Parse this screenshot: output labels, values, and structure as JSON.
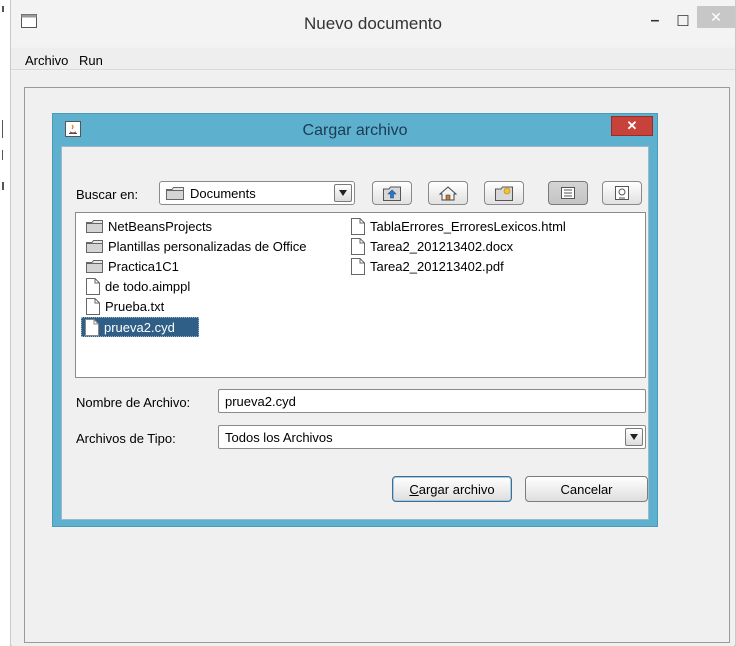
{
  "window": {
    "title": "Nuevo documento",
    "minimize_glyph": "–",
    "maximize_glyph": "☐",
    "close_glyph": "✕"
  },
  "menu": {
    "items": [
      "Archivo",
      "Run"
    ]
  },
  "dialog": {
    "title": "Cargar archivo",
    "close_glyph": "✕",
    "look_in_label": "Buscar en:",
    "look_in_value": "Documents",
    "files": [
      {
        "name": "NetBeansProjects",
        "type": "folder"
      },
      {
        "name": "Plantillas personalizadas de Office",
        "type": "folder"
      },
      {
        "name": "Practica1C1",
        "type": "folder"
      },
      {
        "name": "de todo.aimppl",
        "type": "file"
      },
      {
        "name": "Prueba.txt",
        "type": "file"
      },
      {
        "name": "prueva2.cyd",
        "type": "file",
        "selected": true
      },
      {
        "name": "TablaErrores_ErroresLexicos.html",
        "type": "file"
      },
      {
        "name": "Tarea2_201213402.docx",
        "type": "file"
      },
      {
        "name": "Tarea2_201213402.pdf",
        "type": "file"
      }
    ],
    "filename_label": "Nombre de Archivo:",
    "filename_value": "prueva2.cyd",
    "filetype_label": "Archivos de Tipo:",
    "filetype_value": "Todos los Archivos",
    "open_button_mnemonic": "C",
    "open_button_rest": "argar archivo",
    "cancel_button": "Cancelar"
  },
  "colors": {
    "dialog_frame": "#5eb0cf",
    "selection": "#2f5f86",
    "close_red": "#c7423a"
  }
}
